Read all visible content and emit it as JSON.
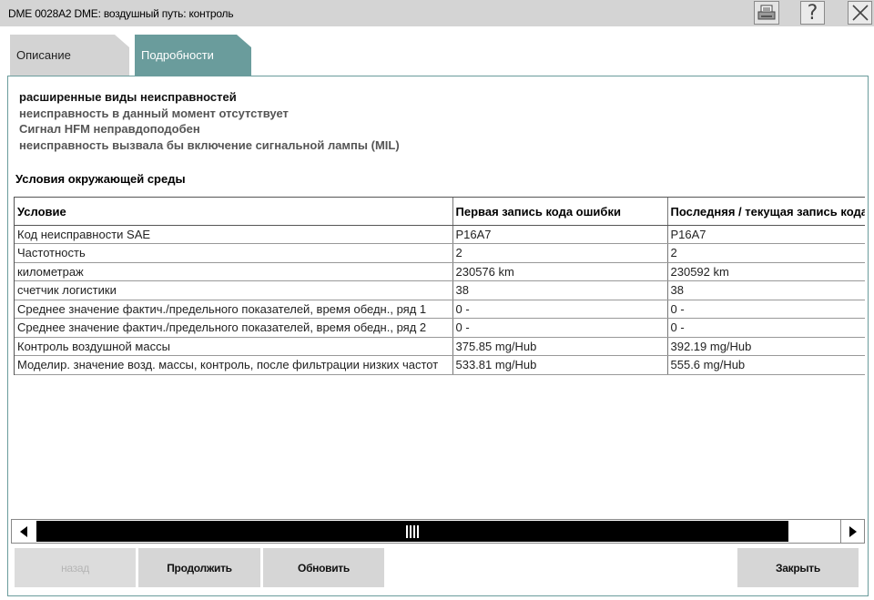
{
  "window": {
    "title": "DME 0028A2 DME: воздушный путь: контроль",
    "print_icon": "printer-icon",
    "help_label": "?",
    "close_icon": "close-icon"
  },
  "tabs": [
    {
      "label": "Описание",
      "active": false
    },
    {
      "label": "Подробности",
      "active": true
    }
  ],
  "fault_info": [
    "расширенные виды неисправностей",
    "неисправность в данный момент отсутствует",
    "Сигнал HFM неправдоподобен",
    "неисправность вызвала бы включение сигнальной лампы (MIL)"
  ],
  "section_title": "Условия окружающей среды",
  "table": {
    "headers": [
      "Условие",
      "Первая запись кода ошибки",
      "Последняя / текущая запись кода ошибки"
    ],
    "rows": [
      [
        "Код неисправности SAE",
        "P16A7",
        "P16A7"
      ],
      [
        "Частотность",
        "2",
        "2"
      ],
      [
        "километраж",
        "230576 km",
        "230592 km"
      ],
      [
        "счетчик логистики",
        "38",
        "38"
      ],
      [
        "Среднее значение фактич./предельного показателей, время обедн., ряд 1",
        "0 -",
        "0 -"
      ],
      [
        "Среднее значение фактич./предельного показателей, время обедн., ряд 2",
        "0 -",
        "0 -"
      ],
      [
        "Контроль воздушной массы",
        "375.85 mg/Hub",
        "392.19 mg/Hub"
      ],
      [
        "Моделир. значение возд. массы, контроль, после фильтрации низких частот",
        "533.81 mg/Hub",
        "555.6 mg/Hub"
      ]
    ]
  },
  "scrollbar": {
    "left_icon": "arrow-left-icon",
    "right_icon": "arrow-right-icon"
  },
  "buttons": {
    "back": "назад",
    "continue": "Продолжить",
    "refresh": "Обновить",
    "close": "Закрыть"
  },
  "colors": {
    "accent": "#6a9c9c",
    "titlebar": "#d4d4d4",
    "button": "#d6d6d6"
  }
}
